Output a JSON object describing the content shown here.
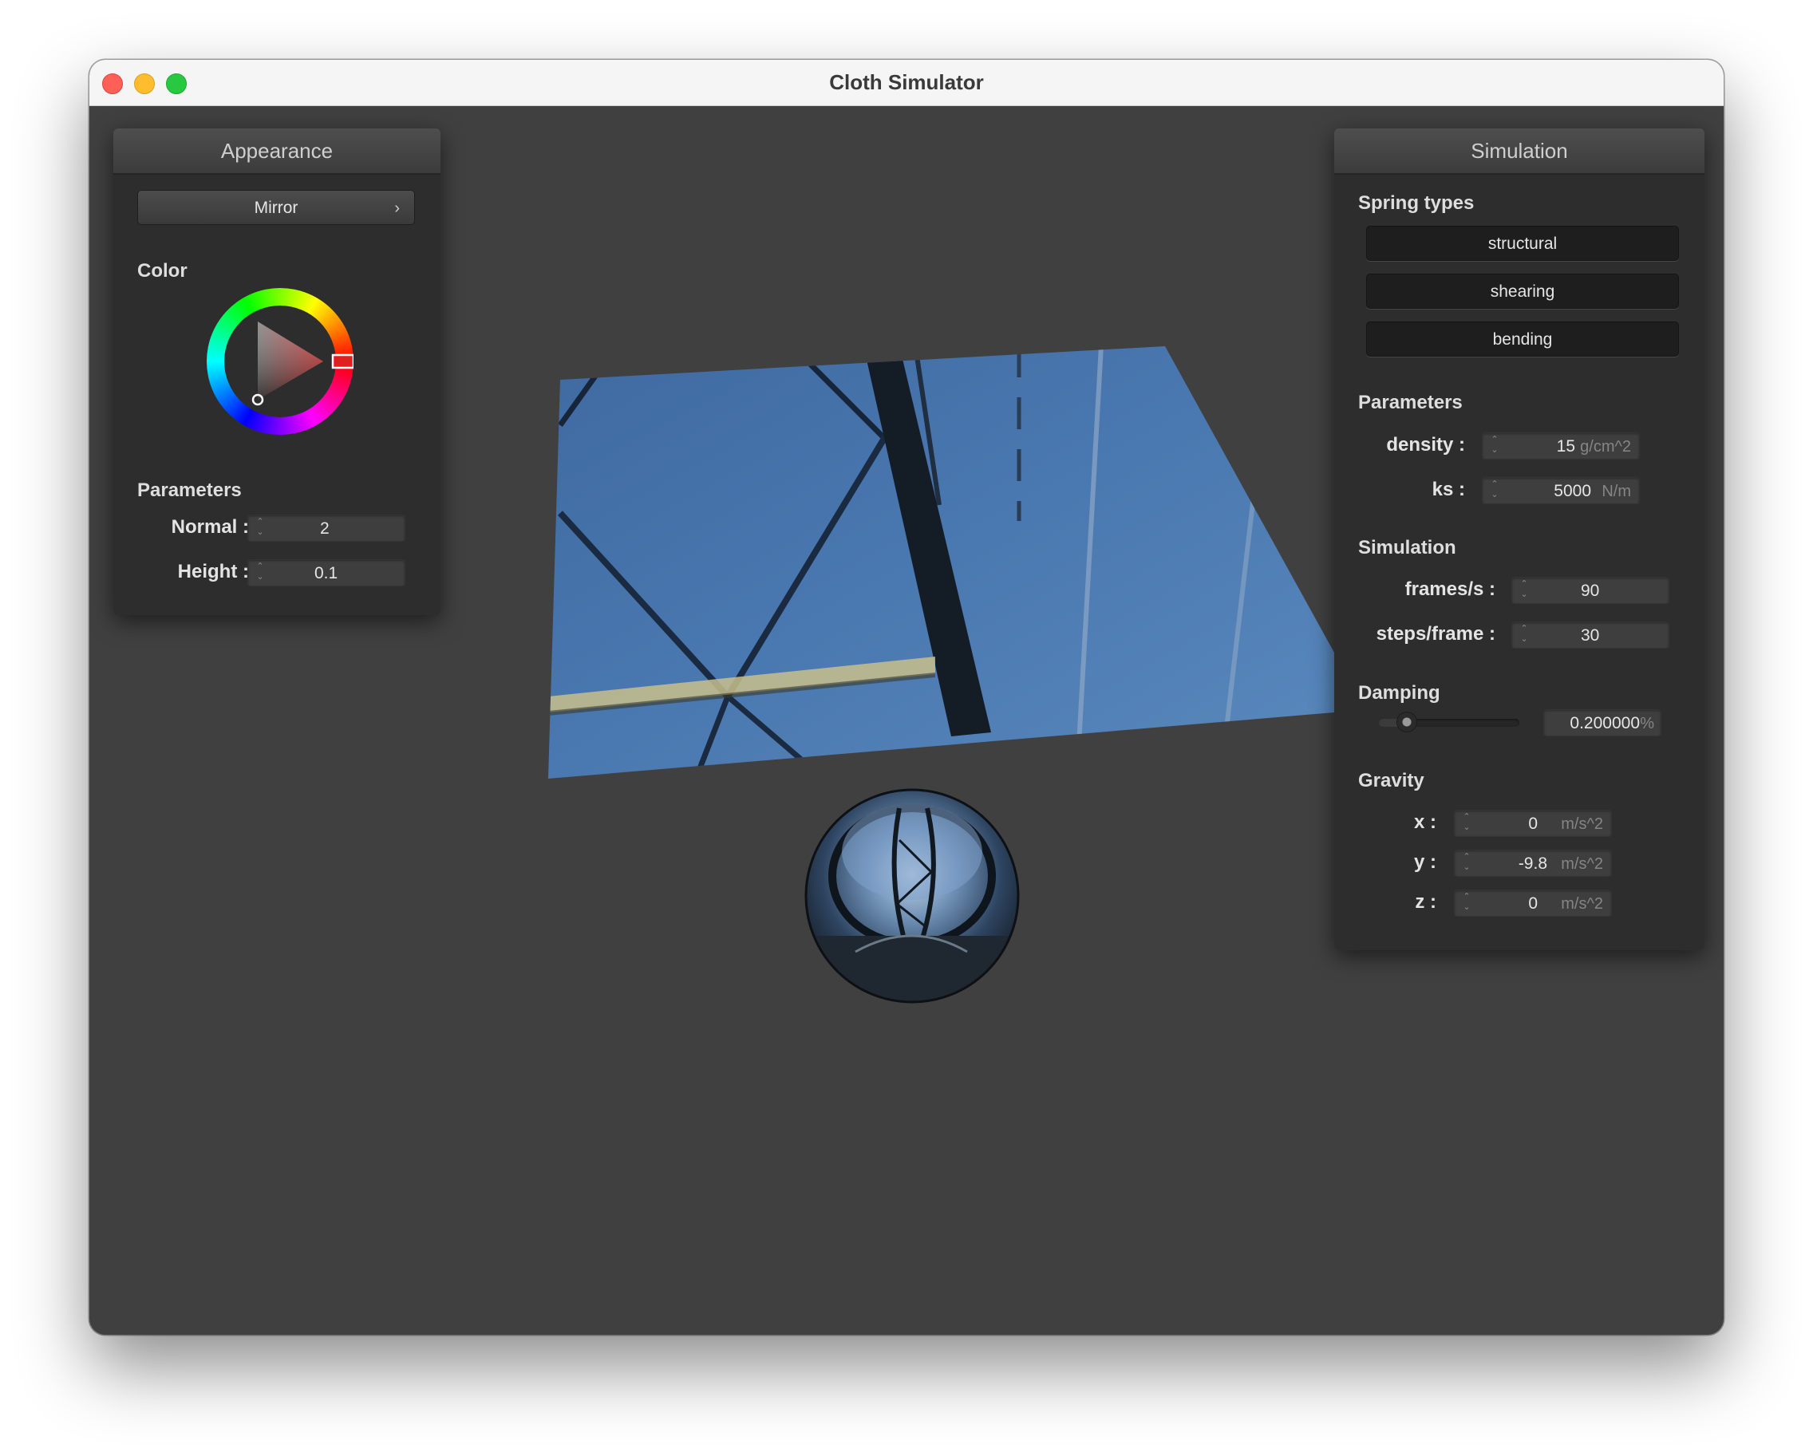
{
  "window": {
    "title": "Cloth Simulator"
  },
  "appearance": {
    "header": "Appearance",
    "shader_button": "Mirror",
    "color_section": "Color",
    "color_hex": "#c82828",
    "params_section": "Parameters",
    "normal": {
      "label": "Normal :",
      "value": "2"
    },
    "height": {
      "label": "Height :",
      "value": "0.1"
    }
  },
  "simulation": {
    "header": "Simulation",
    "spring_section": "Spring types",
    "springs": [
      "structural",
      "shearing",
      "bending"
    ],
    "params_section": "Parameters",
    "density": {
      "label": "density :",
      "value": "15",
      "unit": "g/cm^2"
    },
    "ks": {
      "label": "ks :",
      "value": "5000",
      "unit": "N/m"
    },
    "sim_section": "Simulation",
    "fps": {
      "label": "frames/s :",
      "value": "90"
    },
    "steps": {
      "label": "steps/frame :",
      "value": "30"
    },
    "damping_section": "Damping",
    "damping": {
      "value": "0.200000",
      "unit": "%",
      "level": 0.2
    },
    "gravity_section": "Gravity",
    "gx": {
      "label": "x :",
      "value": "0",
      "unit": "m/s^2"
    },
    "gy": {
      "label": "y :",
      "value": "-9.8",
      "unit": "m/s^2"
    },
    "gz": {
      "label": "z :",
      "value": "0",
      "unit": "m/s^2"
    }
  },
  "colors": {
    "background": "#404040",
    "panel": "#2d2d2d",
    "sky": "#4a76ad"
  },
  "icons": [
    "close-icon",
    "minimize-icon",
    "maximize-icon",
    "chevron-right-icon",
    "spinner-icon"
  ]
}
